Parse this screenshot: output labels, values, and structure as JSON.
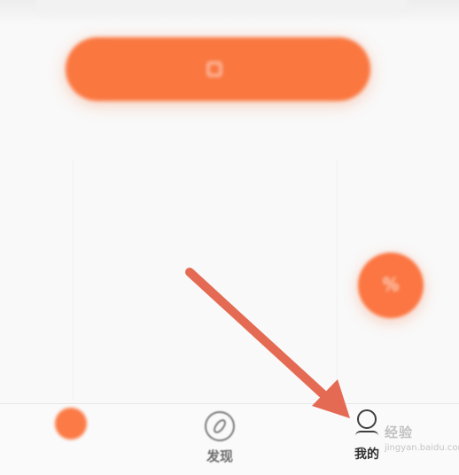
{
  "main": {
    "primary_button_label": "",
    "primary_button_subtext": ""
  },
  "floating_action": {
    "icon": "percent-icon",
    "label": ""
  },
  "tabs": [
    {
      "key": "home",
      "label": "",
      "icon": "home-icon"
    },
    {
      "key": "discover",
      "label": "发现",
      "icon": "compass-icon"
    },
    {
      "key": "mine",
      "label": "我的",
      "icon": "person-icon"
    }
  ],
  "watermark": {
    "title": "经验",
    "subtitle": "jingyan.baidu.com"
  },
  "colors": {
    "accent": "#fa7740",
    "annotation_arrow": "#e56a53",
    "active_tab": "#303030"
  }
}
